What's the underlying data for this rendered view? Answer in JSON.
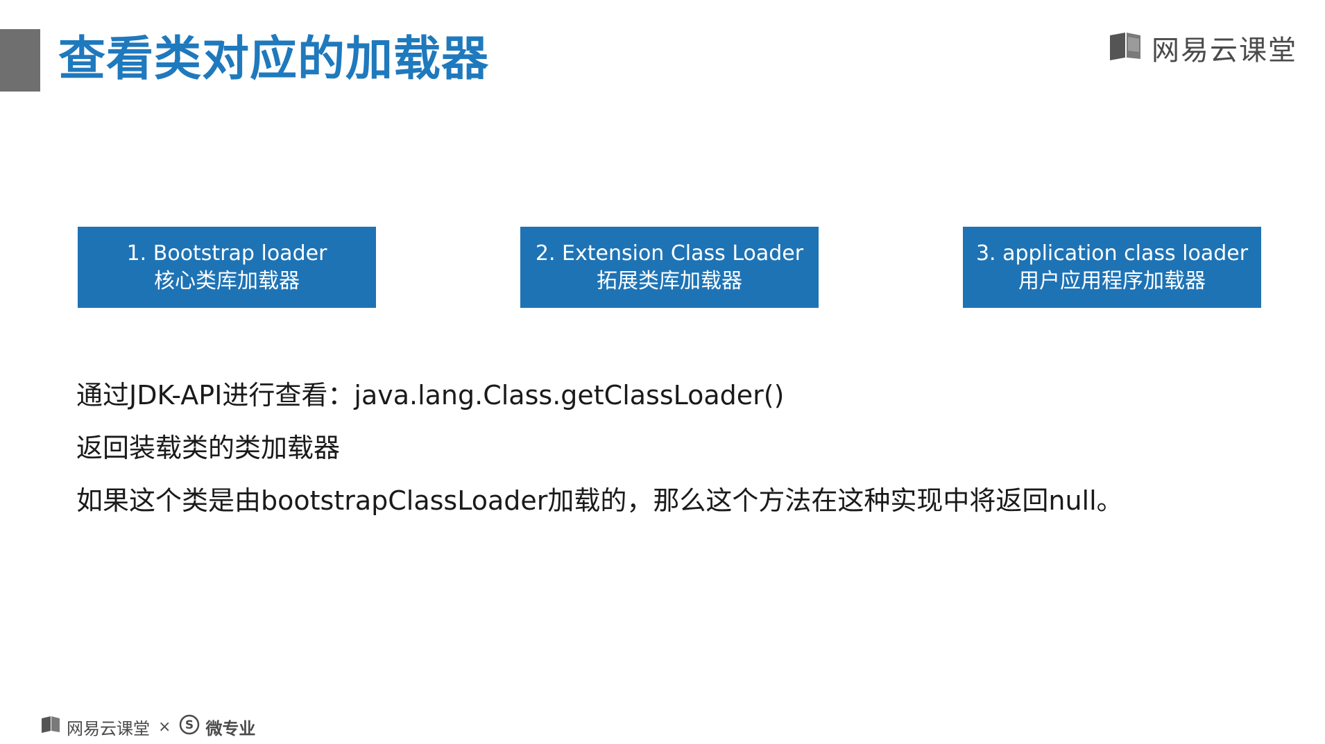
{
  "title": "查看类对应的加载器",
  "brand": {
    "top_text": "网易云课堂",
    "footer_text": "网易云课堂",
    "footer_separator": "×",
    "footer_partner": "微专业"
  },
  "boxes": [
    {
      "line1": "1. Bootstrap loader",
      "line2": "核心类库加载器"
    },
    {
      "line1": "2. Extension Class Loader",
      "line2": "拓展类库加载器"
    },
    {
      "line1": "3. application class loader",
      "line2": "用户应用程序加载器"
    }
  ],
  "body": {
    "line1": "通过JDK-API进行查看：java.lang.Class.getClassLoader()",
    "line2": "返回装载类的类加载器",
    "line3": "如果这个类是由bootstrapClassLoader加载的，那么这个方法在这种实现中将返回null。"
  },
  "colors": {
    "title": "#1f79bd",
    "box_fill": "#1e73b5",
    "accent_bar": "#6f6f6f"
  }
}
